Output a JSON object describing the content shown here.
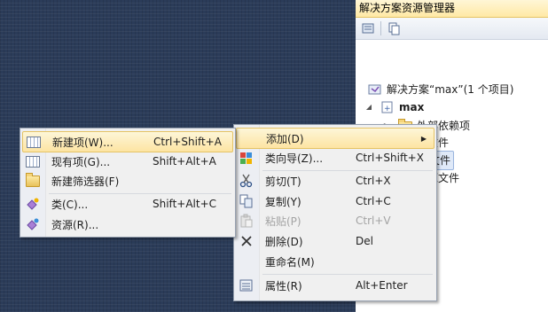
{
  "explorer": {
    "title": "解决方案资源管理器",
    "toolbar": [
      "properties-icon",
      "show-all-files-icon"
    ],
    "tree": {
      "solution": "解决方案“max”(1 个项目)",
      "project": "max",
      "items": [
        "外部依赖项",
        "头文件",
        "源文件",
        "资源文件"
      ]
    }
  },
  "context_menu": {
    "items": [
      {
        "label": "添加(D)",
        "shortcut": "",
        "submenu": true
      },
      {
        "label": "类向导(Z)...",
        "shortcut": "Ctrl+Shift+X"
      },
      {
        "label": "剪切(T)",
        "shortcut": "Ctrl+X"
      },
      {
        "label": "复制(Y)",
        "shortcut": "Ctrl+C"
      },
      {
        "label": "粘贴(P)",
        "shortcut": "Ctrl+V",
        "disabled": true
      },
      {
        "label": "删除(D)",
        "shortcut": "Del"
      },
      {
        "label": "重命名(M)",
        "shortcut": ""
      },
      {
        "label": "属性(R)",
        "shortcut": "Alt+Enter"
      }
    ]
  },
  "add_submenu": {
    "items": [
      {
        "label": "新建项(W)...",
        "shortcut": "Ctrl+Shift+A"
      },
      {
        "label": "现有项(G)...",
        "shortcut": "Shift+Alt+A"
      },
      {
        "label": "新建筛选器(F)",
        "shortcut": ""
      },
      {
        "label": "类(C)...",
        "shortcut": "Shift+Alt+C"
      },
      {
        "label": "资源(R)...",
        "shortcut": ""
      }
    ]
  },
  "colors": {
    "desktop": "#2b3c59",
    "highlight": "#fde4a2",
    "menu_bg": "#f0f0f0"
  }
}
